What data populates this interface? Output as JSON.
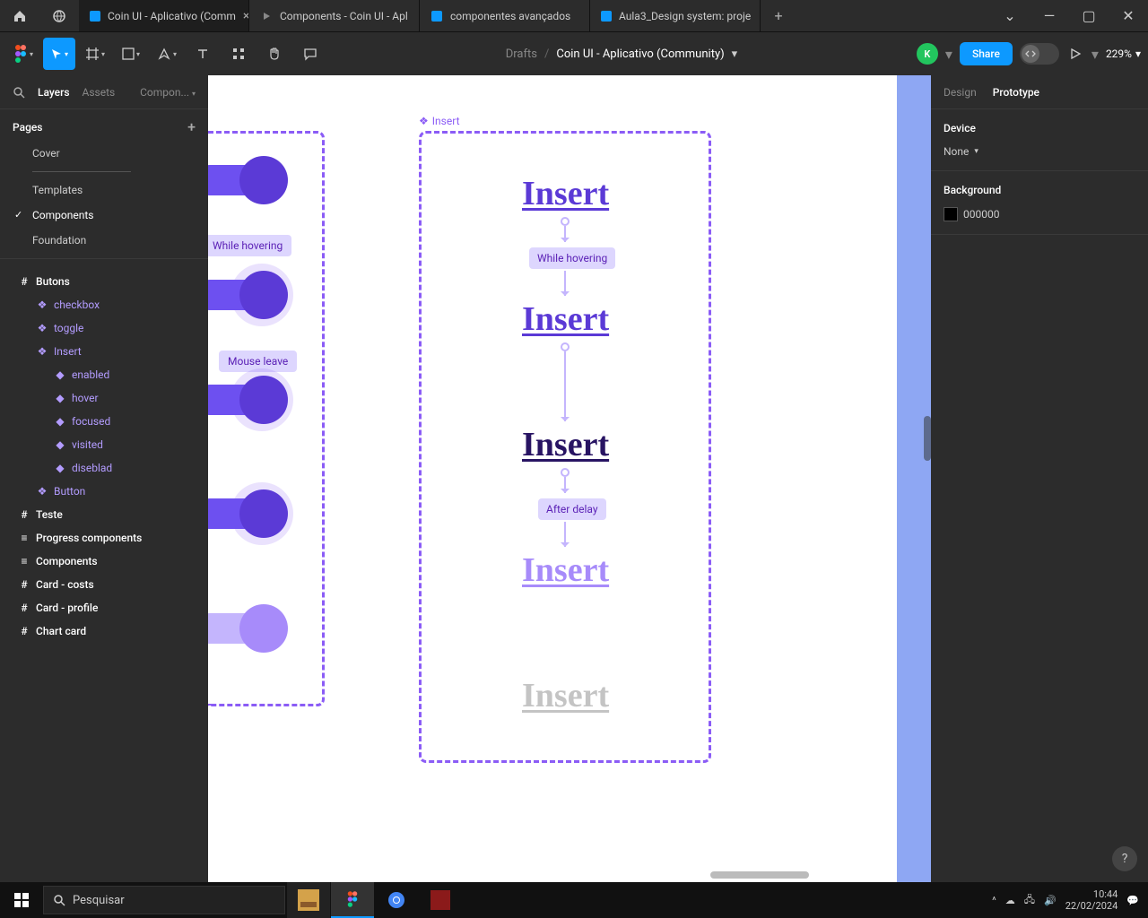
{
  "apptabs": {
    "tabs": [
      {
        "label": "Coin UI - Aplicativo (Comm",
        "active": true,
        "icon": "figma-file"
      },
      {
        "label": "Components - Coin UI - Apl",
        "active": false,
        "icon": "play"
      },
      {
        "label": "componentes avançados",
        "active": false,
        "icon": "figma-file"
      },
      {
        "label": "Aula3_Design system: proje",
        "active": false,
        "icon": "figma-file"
      }
    ]
  },
  "toolbar": {
    "breadcrumb": "Drafts",
    "title": "Coin UI - Aplicativo (Community)",
    "share": "Share",
    "zoom": "229%",
    "avatar_letter": "K"
  },
  "leftpanel": {
    "tabs": {
      "layers": "Layers",
      "assets": "Assets",
      "components": "Compon..."
    },
    "pages_label": "Pages",
    "pages": [
      "Cover",
      "Templates",
      "Components",
      "Foundation"
    ],
    "selected_page": "Components",
    "layers": [
      {
        "type": "frame",
        "label": "Butons"
      },
      {
        "type": "component",
        "label": "checkbox",
        "lvl": 2
      },
      {
        "type": "component",
        "label": "toggle",
        "lvl": 2
      },
      {
        "type": "component",
        "label": "Insert",
        "lvl": 2
      },
      {
        "type": "variant",
        "label": "enabled",
        "lvl": 3
      },
      {
        "type": "variant",
        "label": "hover",
        "lvl": 3
      },
      {
        "type": "variant",
        "label": "focused",
        "lvl": 3
      },
      {
        "type": "variant",
        "label": "visited",
        "lvl": 3
      },
      {
        "type": "variant",
        "label": "diseblad",
        "lvl": 3
      },
      {
        "type": "component",
        "label": "Button",
        "lvl": 2
      },
      {
        "type": "frame",
        "label": "Teste"
      },
      {
        "type": "list",
        "label": "Progress components"
      },
      {
        "type": "list",
        "label": "Components"
      },
      {
        "type": "frame",
        "label": "Card - costs"
      },
      {
        "type": "frame",
        "label": "Card - profile"
      },
      {
        "type": "frame",
        "label": "Chart card"
      }
    ]
  },
  "canvas": {
    "frame_label": "Insert",
    "left_proto_labels": [
      "While hovering",
      "Mouse leave"
    ],
    "inserts": [
      "Insert",
      "Insert",
      "Insert",
      "Insert",
      "Insert"
    ],
    "flow_labels": [
      "While hovering",
      "After delay"
    ]
  },
  "rightpanel": {
    "tabs": {
      "design": "Design",
      "prototype": "Prototype"
    },
    "device_label": "Device",
    "device_value": "None",
    "background_label": "Background",
    "background_value": "000000"
  },
  "taskbar": {
    "search_placeholder": "Pesquisar",
    "time": "10:44",
    "date": "22/02/2024"
  }
}
